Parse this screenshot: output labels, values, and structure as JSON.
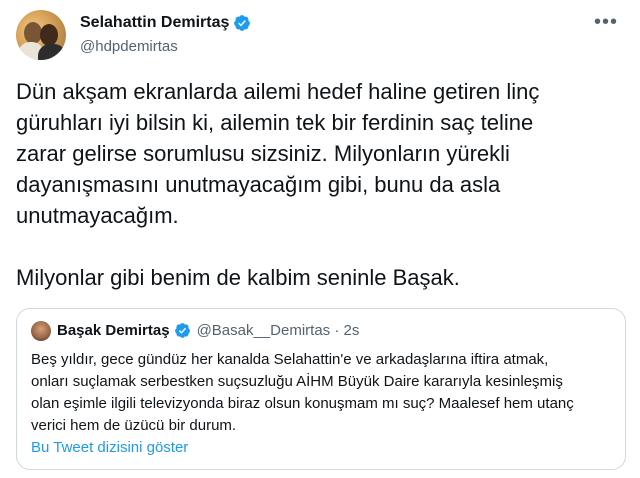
{
  "tweet": {
    "author_name": "Selahattin Demirtaş",
    "handle": "@hdpdemirtas",
    "text": "Dün akşam ekranlarda ailemi hedef haline getiren linç\ngüruhları iyi bilsin ki, ailemin tek bir ferdinin saç teline\nzarar gelirse sorumlusu sizsiniz. Milyonların yürekli\ndayanışmasını unutmayacağım gibi, bunu da asla\nunutmayacağım.\n\nMilyonlar gibi benim de kalbim seninle Başak."
  },
  "quote": {
    "author_name": "Başak Demirtaş",
    "handle": "@Basak__Demirtas · 2s",
    "text": "Beş yıldır, gece gündüz her kanalda Selahattin'e ve arkadaşlarına iftira atmak,\nonları suçlamak serbestken suçsuzluğu AİHM Büyük Daire kararıyla kesinleşmiş\nolan eşimle ilgili televizyonda biraz olsun konuşmam mı suç? Maalesef hem utanç\nverici hem de üzücü bir durum.",
    "show_thread": "Bu Tweet dizisini göster"
  },
  "colors": {
    "accent": "#1d9bf0",
    "secondary_text": "#536471",
    "border": "#cfd9de"
  },
  "icons": {
    "verified": "verified-badge-icon",
    "more": "more-options-icon"
  }
}
